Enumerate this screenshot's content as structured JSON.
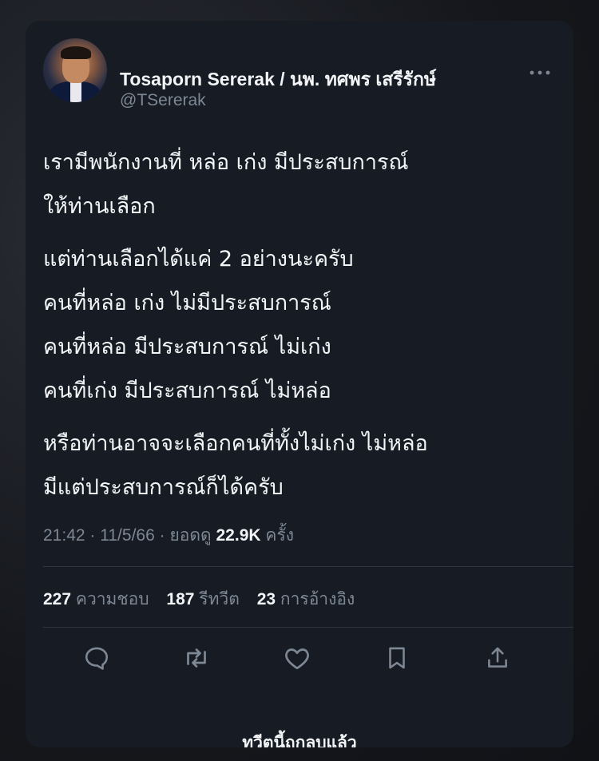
{
  "tweet": {
    "display_name": "Tosaporn Sererak / นพ. ทศพร เสรีรักษ์",
    "handle": "@TSererak",
    "text_paragraphs": [
      [
        "เรามีพนักงานที่ หล่อ เก่ง มีประสบการณ์",
        "ให้ท่านเลือก"
      ],
      [
        "แต่ท่านเลือกได้แค่ 2 อย่างนะครับ",
        "คนที่หล่อ เก่ง ไม่มีประสบการณ์",
        "คนที่หล่อ มีประสบการณ์ ไม่เก่ง",
        "คนที่เก่ง มีประสบการณ์ ไม่หล่อ"
      ],
      [
        "หรือท่านอาจจะเลือกคนที่ทั้งไม่เก่ง ไม่หล่อ",
        "มีแต่ประสบการณ์ก็ได้ครับ"
      ]
    ],
    "time": "21:42",
    "date": "11/5/66",
    "separator": "·",
    "views_label": "ยอดดู",
    "views_count": "22.9K",
    "views_unit": "ครั้ง",
    "stats": {
      "likes_count": "227",
      "likes_label": "ความชอบ",
      "retweets_count": "187",
      "retweets_label": "รีทวีต",
      "quotes_count": "23",
      "quotes_label": "การอ้างอิง"
    },
    "actions": [
      "reply-icon",
      "retweet-icon",
      "like-icon",
      "bookmark-icon",
      "share-icon"
    ],
    "deleted_note": "ทวีตนี้ถูกลบแล้ว"
  },
  "colors": {
    "card_background": "#161b24",
    "text_primary": "#f2f4f6",
    "text_secondary": "#7d8894",
    "divider": "#2f3640"
  }
}
